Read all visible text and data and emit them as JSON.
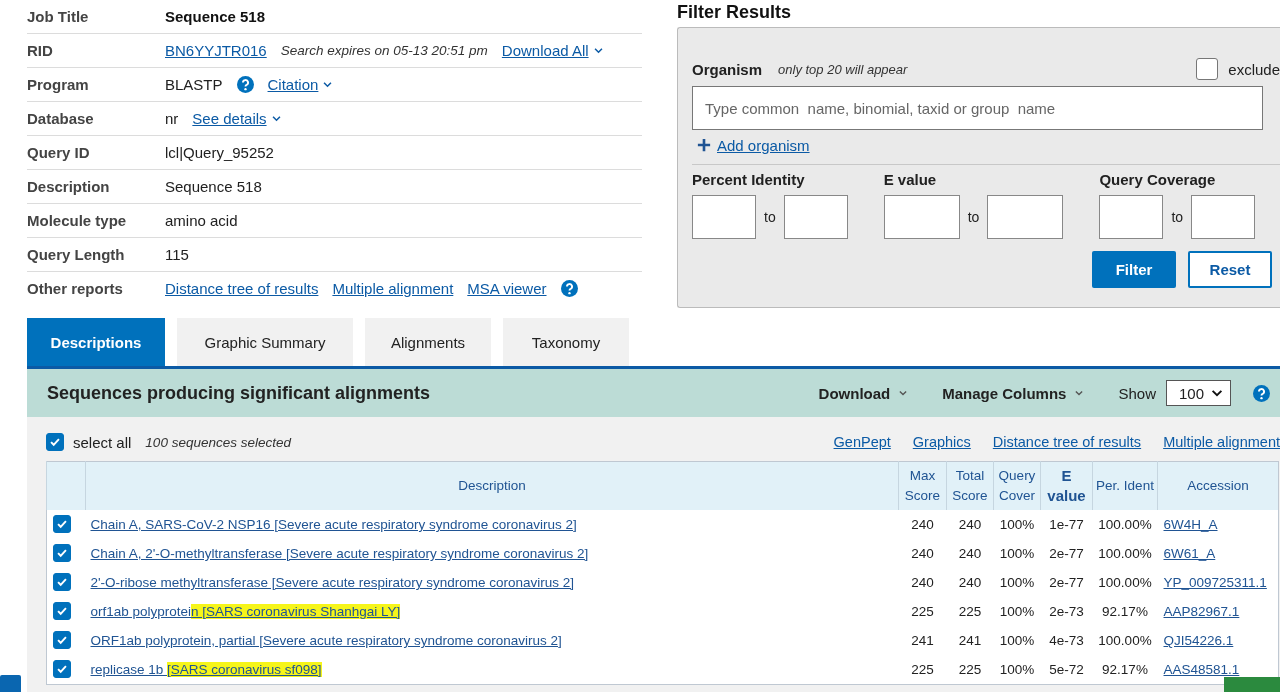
{
  "job_info": [
    {
      "label": "Job Title",
      "items": [
        {
          "kind": "bold",
          "text": "Sequence 518"
        }
      ]
    },
    {
      "label": "RID",
      "items": [
        {
          "kind": "link",
          "text": "BN6YYJTR016"
        },
        {
          "kind": "note",
          "text": "Search expires on 05-13 20:51 pm"
        },
        {
          "kind": "link",
          "text": "Download All",
          "dropdown": true
        }
      ]
    },
    {
      "label": "Program",
      "items": [
        {
          "kind": "text",
          "text": "BLASTP"
        },
        {
          "kind": "help"
        },
        {
          "kind": "link",
          "text": "Citation",
          "dropdown": true
        }
      ]
    },
    {
      "label": "Database",
      "items": [
        {
          "kind": "text",
          "text": "nr"
        },
        {
          "kind": "link",
          "text": "See details",
          "dropdown": true
        }
      ]
    },
    {
      "label": "Query ID",
      "items": [
        {
          "kind": "text",
          "text": "lcl|Query_95252"
        }
      ]
    },
    {
      "label": "Description",
      "items": [
        {
          "kind": "text",
          "text": "Sequence 518"
        }
      ]
    },
    {
      "label": "Molecule type",
      "items": [
        {
          "kind": "text",
          "text": "amino acid"
        }
      ]
    },
    {
      "label": "Query Length",
      "items": [
        {
          "kind": "text",
          "text": "115"
        }
      ]
    },
    {
      "label": "Other reports",
      "items": [
        {
          "kind": "link",
          "text": "Distance tree of results"
        },
        {
          "kind": "link",
          "text": "Multiple alignment"
        },
        {
          "kind": "link",
          "text": "MSA viewer"
        },
        {
          "kind": "help"
        }
      ]
    }
  ],
  "filter": {
    "title": "Filter Results",
    "organism_label": "Organism",
    "organism_note": "only top 20 will appear",
    "exclude": {
      "label": "exclude",
      "checked": false
    },
    "organism_field": {
      "placeholder": "Type common  name, binomial, taxid or group  name"
    },
    "add_organism": "Add organism",
    "ranges": [
      {
        "label": "Percent Identity",
        "to": "to"
      },
      {
        "label": "E value",
        "to": "to"
      },
      {
        "label": "Query Coverage",
        "to": "to"
      }
    ],
    "buttons": [
      {
        "label": "Filter",
        "kind": "primary"
      },
      {
        "label": "Reset",
        "kind": "secondary"
      }
    ]
  },
  "tabs": [
    {
      "label": "Descriptions",
      "selected": true
    },
    {
      "label": "Graphic Summary",
      "selected": false
    },
    {
      "label": "Alignments",
      "selected": false
    },
    {
      "label": "Taxonomy",
      "selected": false
    }
  ],
  "results": {
    "title": "Sequences producing significant alignments",
    "menus": [
      "Download",
      "Manage Columns"
    ],
    "show_label": "Show",
    "show_value": "100",
    "select_all": {
      "label": "select all",
      "checked": true
    },
    "selected_count": "100 sequences selected",
    "links": [
      "GenPept",
      "Graphics",
      "Distance tree of results",
      "Multiple alignment"
    ],
    "columns": [
      {
        "label": "Description",
        "sorted": false
      },
      {
        "label": "Max Score",
        "sorted": false
      },
      {
        "label": "Total Score",
        "sorted": false
      },
      {
        "label": "Query Cover",
        "sorted": false
      },
      {
        "label": "E value",
        "sorted": true
      },
      {
        "label": "Per. Ident",
        "sorted": false
      },
      {
        "label": "Accession",
        "sorted": false
      }
    ],
    "rows": [
      {
        "checked": true,
        "description": [
          {
            "text": "Chain A, SARS-CoV-2 NSP16 [Severe acute respiratory syndrome coronavirus 2]",
            "highlighted": false
          }
        ],
        "max_score": "240",
        "total_score": "240",
        "query_cover": "100%",
        "e_value": "1e-77",
        "per_ident": "100.00%",
        "accession": "6W4H_A"
      },
      {
        "checked": true,
        "description": [
          {
            "text": "Chain A, 2'-O-methyltransferase [Severe acute respiratory syndrome coronavirus 2]",
            "highlighted": false
          }
        ],
        "max_score": "240",
        "total_score": "240",
        "query_cover": "100%",
        "e_value": "2e-77",
        "per_ident": "100.00%",
        "accession": "6W61_A"
      },
      {
        "checked": true,
        "description": [
          {
            "text": "2'-O-ribose methyltransferase [Severe acute respiratory syndrome coronavirus 2]",
            "highlighted": false
          }
        ],
        "max_score": "240",
        "total_score": "240",
        "query_cover": "100%",
        "e_value": "2e-77",
        "per_ident": "100.00%",
        "accession": "YP_009725311.1"
      },
      {
        "checked": true,
        "description": [
          {
            "text": "orf1ab polyprotei",
            "highlighted": false
          },
          {
            "text": "n [SARS coronavirus Shanhgai LY]",
            "highlighted": true
          }
        ],
        "max_score": "225",
        "total_score": "225",
        "query_cover": "100%",
        "e_value": "2e-73",
        "per_ident": "92.17%",
        "accession": "AAP82967.1"
      },
      {
        "checked": true,
        "description": [
          {
            "text": "ORF1ab polyprotein, partial [Severe acute respiratory syndrome coronavirus 2]",
            "highlighted": false
          }
        ],
        "max_score": "241",
        "total_score": "241",
        "query_cover": "100%",
        "e_value": "4e-73",
        "per_ident": "100.00%",
        "accession": "QJI54226.1"
      },
      {
        "checked": true,
        "description": [
          {
            "text": "replicase 1b ",
            "highlighted": false
          },
          {
            "text": "[SARS coronavirus sf098]",
            "highlighted": true
          }
        ],
        "max_score": "225",
        "total_score": "225",
        "query_cover": "100%",
        "e_value": "5e-72",
        "per_ident": "92.17%",
        "accession": "AAS48581.1"
      }
    ]
  }
}
